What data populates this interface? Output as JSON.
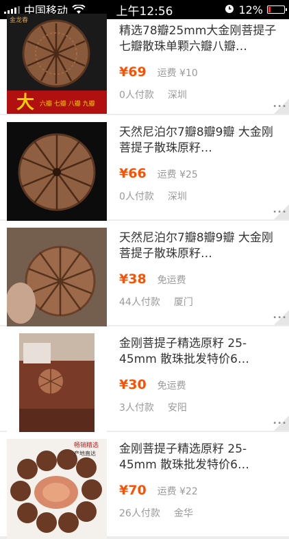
{
  "status_bar": {
    "carrier": "中国移动",
    "time": "上午12:56",
    "battery": "12%"
  },
  "colors": {
    "price": "#ff5000",
    "muted": "#999999"
  },
  "items": [
    {
      "title": "精选78瓣25mm大金刚菩提子七瓣散珠单颗六瓣八瓣…",
      "price": "¥69",
      "shipping": "运费 ¥10",
      "sales": "0人付款",
      "location": "深圳",
      "banner_char": "大",
      "banner_text": "六瓣 七瓣 八瓣 九瓣",
      "logo_text": "金龙春"
    },
    {
      "title": "天然尼泊尔7瓣8瓣9瓣 大金刚菩提子散珠原籽…",
      "price": "¥66",
      "shipping": "运费 ¥25",
      "sales": "0人付款",
      "location": "深圳"
    },
    {
      "title": "天然尼泊尔7瓣8瓣9瓣 大金刚菩提子散珠原籽…",
      "price": "¥38",
      "shipping": "免运费",
      "sales": "44人付款",
      "location": "厦门"
    },
    {
      "title": "金刚菩提子精选原籽 25-45mm 散珠批发特价6…",
      "price": "¥30",
      "shipping": "免运费",
      "sales": "3人付款",
      "location": "安阳"
    },
    {
      "title": "金刚菩提子精选原籽 25-45mm 散珠批发特价6…",
      "price": "¥70",
      "shipping": "运费 ¥22",
      "sales": "26人付款",
      "location": "金华",
      "stamp": "畅销精选",
      "stamp_sub": "产地直达"
    }
  ]
}
